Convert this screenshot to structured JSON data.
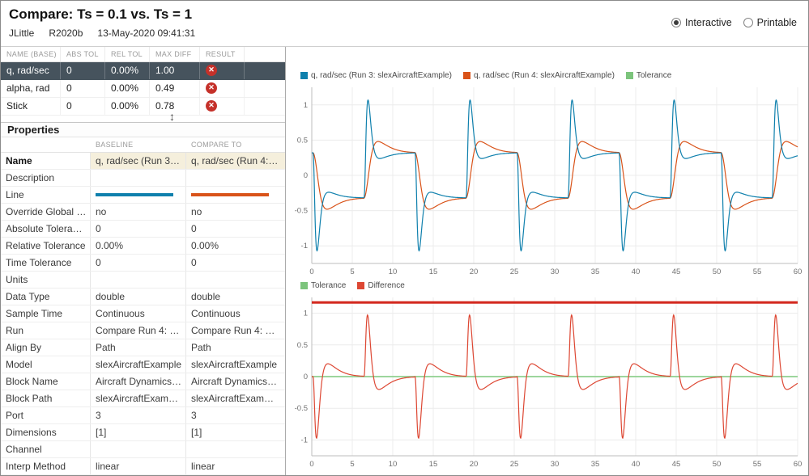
{
  "header": {
    "title": "Compare: Ts = 0.1 vs. Ts = 1",
    "author": "JLittle",
    "release": "R2020b",
    "timestamp": "13-May-2020 09:41:31",
    "view_options": [
      {
        "label": "Interactive",
        "selected": true
      },
      {
        "label": "Printable",
        "selected": false
      }
    ]
  },
  "comparison_table": {
    "columns": [
      "NAME (BASE)",
      "ABS TOL",
      "REL TOL",
      "MAX DIFF",
      "RESULT"
    ],
    "rows": [
      {
        "name": "q, rad/sec",
        "abs_tol": "0",
        "rel_tol": "0.00%",
        "max_diff": "1.00",
        "result": "fail",
        "selected": true
      },
      {
        "name": "alpha, rad",
        "abs_tol": "0",
        "rel_tol": "0.00%",
        "max_diff": "0.49",
        "result": "fail",
        "selected": false
      },
      {
        "name": "Stick",
        "abs_tol": "0",
        "rel_tol": "0.00%",
        "max_diff": "0.78",
        "result": "fail",
        "selected": false
      }
    ],
    "selected_row_bg": "#46535d",
    "fail_color": "#c5312a"
  },
  "splitter": {
    "icon": "↕"
  },
  "properties_panel": {
    "title": "Properties",
    "columns": [
      "BASELINE",
      "COMPARE TO"
    ],
    "rows": [
      {
        "label": "Name",
        "baseline": "q, rad/sec (Run 3…",
        "compare": "q, rad/sec (Run 4:…",
        "highlight": true
      },
      {
        "label": "Description",
        "baseline": "",
        "compare": ""
      },
      {
        "label": "Line",
        "type": "line",
        "baseline": "#0f80ad",
        "compare": "#d95319"
      },
      {
        "label": "Override Global …",
        "baseline": "no",
        "compare": "no"
      },
      {
        "label": "Absolute Tolera…",
        "baseline": "0",
        "compare": "0"
      },
      {
        "label": "Relative Tolerance",
        "baseline": "0.00%",
        "compare": "0.00%"
      },
      {
        "label": "Time Tolerance",
        "baseline": "0",
        "compare": "0"
      },
      {
        "label": "Units",
        "baseline": "",
        "compare": ""
      },
      {
        "label": "Data Type",
        "baseline": "double",
        "compare": "double"
      },
      {
        "label": "Sample Time",
        "baseline": "Continuous",
        "compare": "Continuous"
      },
      {
        "label": "Run",
        "baseline": "Compare Run 4: …",
        "compare": "Compare Run 4: …"
      },
      {
        "label": "Align By",
        "baseline": "Path",
        "compare": "Path"
      },
      {
        "label": "Model",
        "baseline": "slexAircraftExample",
        "compare": "slexAircraftExample"
      },
      {
        "label": "Block Name",
        "baseline": "Aircraft Dynamics…",
        "compare": "Aircraft Dynamics…"
      },
      {
        "label": "Block Path",
        "baseline": "slexAircraftExam…",
        "compare": "slexAircraftExam…"
      },
      {
        "label": "Port",
        "baseline": "3",
        "compare": "3"
      },
      {
        "label": "Dimensions",
        "baseline": "[1]",
        "compare": "[1]"
      },
      {
        "label": "Channel",
        "baseline": "",
        "compare": ""
      },
      {
        "label": "Interp Method",
        "baseline": "linear",
        "compare": "linear"
      }
    ]
  },
  "chart_data": [
    {
      "name": "signals_plot",
      "type": "line",
      "xlim": [
        0,
        60
      ],
      "ylim": [
        -1.25,
        1.25
      ],
      "xticks": [
        0,
        5,
        10,
        15,
        20,
        25,
        30,
        35,
        40,
        45,
        50,
        55,
        60
      ],
      "yticks": [
        -1,
        -0.5,
        0,
        0.5,
        1
      ],
      "grid": true,
      "legend_position": "top-left",
      "legend": [
        {
          "label": "q, rad/sec (Run 3: slexAircraftExample)",
          "color": "#0f80ad"
        },
        {
          "label": "q, rad/sec (Run 4: slexAircraftExample)",
          "color": "#d95319"
        },
        {
          "label": "Tolerance",
          "color": "#7cc47c"
        }
      ],
      "signal_model": {
        "description": "Pitch-rate responses to a square-wave stick input; input toggles sign every 6.3 s starting at t=0.15 s, first transition negative. Run 3 (Ts=0.1) overshoots sharply to about +/-1.12 then settles at +/-0.32; Run 4 (Ts=1) rises slowly to about +/-0.49 then settles at +/-0.32.",
        "toggle_start": 0.15,
        "toggle_interval": 6.3,
        "num_toggles": 10,
        "series": [
          {
            "name": "q, rad/sec (Run 3: slexAircraftExample)",
            "color": "#0f80ad",
            "settle": 0.32,
            "peak": 1.12,
            "peak_time": 0.5,
            "rise_width": 0.22,
            "sharp": true,
            "undershoot": 0.1,
            "undershoot_time": 1.4
          },
          {
            "name": "q, rad/sec (Run 4: slexAircraftExample)",
            "color": "#d95319",
            "settle": 0.32,
            "peak": 0.49,
            "peak_time": 1.5,
            "rise_width": 0.8,
            "sharp": false
          }
        ]
      }
    },
    {
      "name": "difference_plot",
      "type": "line",
      "xlim": [
        0,
        60
      ],
      "ylim": [
        -1.25,
        1.25
      ],
      "xticks": [
        0,
        5,
        10,
        15,
        20,
        25,
        30,
        35,
        40,
        45,
        50,
        55,
        60
      ],
      "yticks": [
        -1,
        -0.5,
        0,
        0.5,
        1
      ],
      "grid": true,
      "legend_position": "top-left",
      "legend": [
        {
          "label": "Tolerance",
          "color": "#7cc47c"
        },
        {
          "label": "Difference",
          "color": "#dd4733"
        }
      ],
      "tolerance_line": {
        "value": 0,
        "color": "#8fd18f"
      },
      "out_of_tolerance_bar": {
        "value": 1.17,
        "color": "#d3281e",
        "note": "red bar across full time range: difference exceeds tolerance everywhere"
      },
      "difference_series": {
        "definition": "baseline minus compare signal",
        "scale": 0.85,
        "color": "#dd4733",
        "peak_abs": 1.0,
        "spikes_at_toggles": true
      }
    }
  ]
}
